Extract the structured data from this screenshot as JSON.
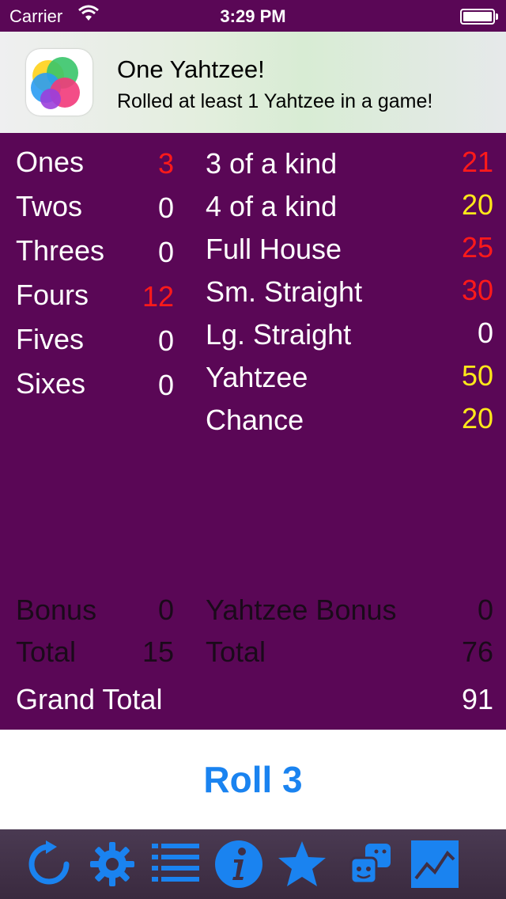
{
  "status_bar": {
    "carrier": "Carrier",
    "time": "3:29 PM"
  },
  "banner": {
    "icon": "game-center-icon",
    "title": "One Yahtzee!",
    "subtitle": "Rolled at least 1 Yahtzee in a game!"
  },
  "upper": [
    {
      "label": "Ones",
      "value": "3",
      "color": "#ff1a1a"
    },
    {
      "label": "Twos",
      "value": "0",
      "color": "#ffffff"
    },
    {
      "label": "Threes",
      "value": "0",
      "color": "#ffffff"
    },
    {
      "label": "Fours",
      "value": "12",
      "color": "#ff1a1a"
    },
    {
      "label": "Fives",
      "value": "0",
      "color": "#ffffff"
    },
    {
      "label": "Sixes",
      "value": "0",
      "color": "#ffffff"
    }
  ],
  "lower": [
    {
      "label": "3 of a kind",
      "value": "21",
      "color": "#ff1a1a"
    },
    {
      "label": "4 of a kind",
      "value": "20",
      "color": "#ffe81a"
    },
    {
      "label": "Full House",
      "value": "25",
      "color": "#ff1a1a"
    },
    {
      "label": "Sm. Straight",
      "value": "30",
      "color": "#ff1a1a"
    },
    {
      "label": "Lg. Straight",
      "value": "0",
      "color": "#ffffff"
    },
    {
      "label": "Yahtzee",
      "value": "50",
      "color": "#ffe81a"
    },
    {
      "label": "Chance",
      "value": "20",
      "color": "#ffe81a"
    }
  ],
  "totals": {
    "bonus_label": "Bonus",
    "bonus_value": "0",
    "upper_total_label": "Total",
    "upper_total_value": "15",
    "yahtzee_bonus_label": "Yahtzee Bonus",
    "yahtzee_bonus_value": "0",
    "lower_total_label": "Total",
    "lower_total_value": "76",
    "grand_total_label": "Grand Total",
    "grand_total_value": "91"
  },
  "roll_button": {
    "label": "Roll 3",
    "color": "#1a83f0"
  },
  "tab_bar": {
    "items": [
      {
        "icon": "refresh-icon"
      },
      {
        "icon": "gear-icon"
      },
      {
        "icon": "list-icon"
      },
      {
        "icon": "info-icon"
      },
      {
        "icon": "star-icon"
      },
      {
        "icon": "dice-icon"
      },
      {
        "icon": "chart-icon"
      }
    ],
    "icon_color": "#1a83f0"
  }
}
